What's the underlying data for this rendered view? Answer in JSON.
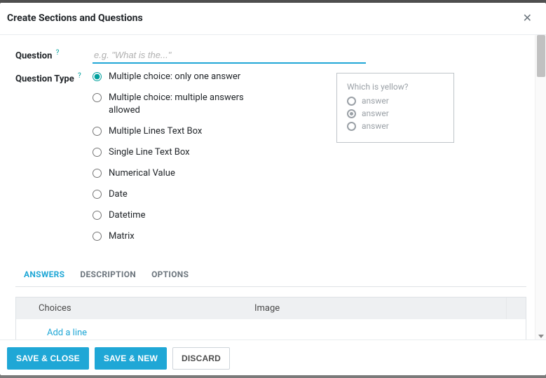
{
  "modal": {
    "title": "Create Sections and Questions",
    "close_label": "✕"
  },
  "form": {
    "question_label": "Question",
    "question_help": "?",
    "question_value": "",
    "question_placeholder": "e.g. \"What is the...\"",
    "type_label": "Question Type",
    "type_help": "?",
    "types": [
      {
        "label": "Multiple choice: only one answer",
        "checked": true
      },
      {
        "label": "Multiple choice: multiple answers allowed",
        "checked": false
      },
      {
        "label": "Multiple Lines Text Box",
        "checked": false
      },
      {
        "label": "Single Line Text Box",
        "checked": false
      },
      {
        "label": "Numerical Value",
        "checked": false
      },
      {
        "label": "Date",
        "checked": false
      },
      {
        "label": "Datetime",
        "checked": false
      },
      {
        "label": "Matrix",
        "checked": false
      }
    ]
  },
  "preview": {
    "title": "Which is yellow?",
    "options": [
      {
        "label": "answer",
        "selected": false
      },
      {
        "label": "answer",
        "selected": true
      },
      {
        "label": "answer",
        "selected": false
      }
    ]
  },
  "tabs": [
    {
      "label": "ANSWERS",
      "active": true
    },
    {
      "label": "DESCRIPTION",
      "active": false
    },
    {
      "label": "OPTIONS",
      "active": false
    }
  ],
  "grid": {
    "columns": {
      "choices": "Choices",
      "image": "Image"
    },
    "add_line": "Add a line"
  },
  "footer": {
    "save_close": "SAVE & CLOSE",
    "save_new": "SAVE & NEW",
    "discard": "DISCARD"
  }
}
